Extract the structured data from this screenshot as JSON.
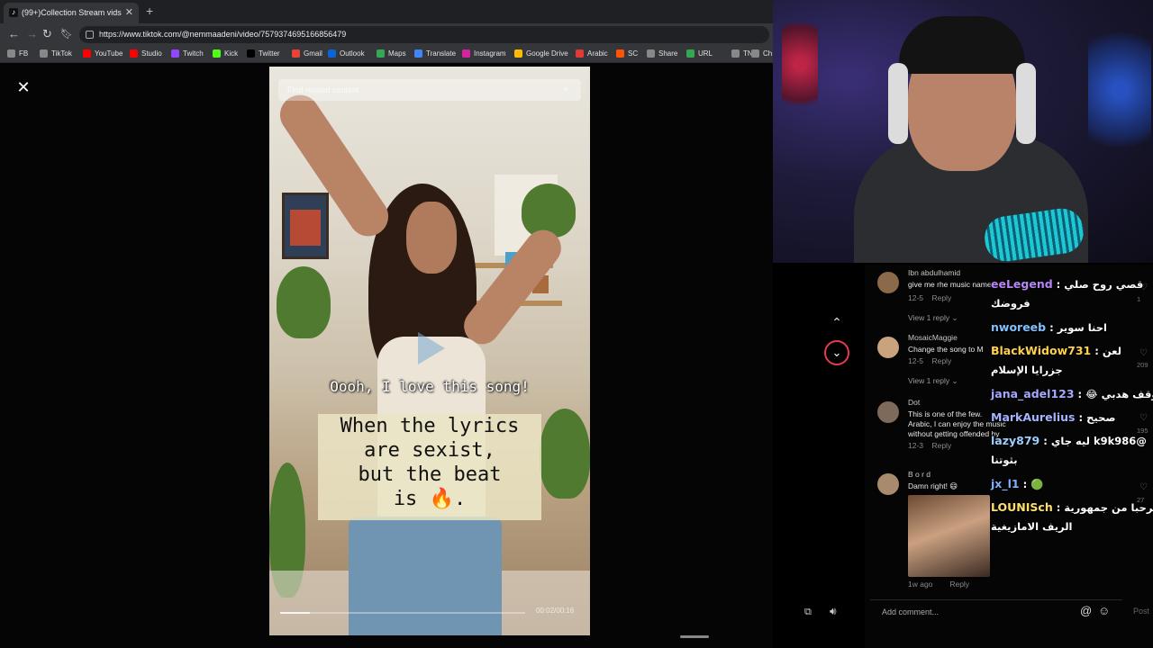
{
  "browser": {
    "tab_title": "(99+)Collection Stream vids",
    "url": "https://www.tiktok.com/@nemmaadeni/video/7579374695166856479",
    "bookmarks": [
      {
        "label": "FB",
        "color": "#888"
      },
      {
        "label": "TikTok",
        "color": "#888"
      },
      {
        "label": "YouTube",
        "color": "#ff0000"
      },
      {
        "label": "Studio",
        "color": "#ff0000"
      },
      {
        "label": "Twitch",
        "color": "#9146ff"
      },
      {
        "label": "Kick",
        "color": "#53fc18"
      },
      {
        "label": "Twitter",
        "color": "#000000"
      },
      {
        "label": "Gmail",
        "color": "#ea4335"
      },
      {
        "label": "Outlook",
        "color": "#0a64d8"
      },
      {
        "label": "Maps",
        "color": "#34a853"
      },
      {
        "label": "Translate",
        "color": "#4285f4"
      },
      {
        "label": "Instagram",
        "color": "#d6249f"
      },
      {
        "label": "Google Drive",
        "color": "#fbbc04"
      },
      {
        "label": "Arabic",
        "color": "#e53935"
      },
      {
        "label": "SC",
        "color": "#ff5500"
      },
      {
        "label": "Share",
        "color": "#888"
      },
      {
        "label": "URL",
        "color": "#34a853"
      },
      {
        "label": "TN",
        "color": "#888"
      },
      {
        "label": "Ch",
        "color": "#888"
      }
    ]
  },
  "video": {
    "search_placeholder": "Find related content",
    "lyric_small": "Oooh, I love this song!",
    "caption_lines": [
      "When the lyrics",
      "are sexist,",
      "but the beat",
      "is 🔥."
    ],
    "timestamp": "00:02/00:16",
    "progress_fraction": 0.12
  },
  "comments": [
    {
      "user": "Ibn abdulhamid",
      "text": "give me rhe music name",
      "date": "12-5",
      "reply": "Reply",
      "view_replies": "View 1 reply ⌄",
      "avatar_color": "#8a6a4a"
    },
    {
      "user": "MosaicMaggie",
      "text": "Change the song to M",
      "date": "12-5",
      "reply": "Reply",
      "view_replies": "View 1 reply ⌄",
      "avatar_color": "#c9a27e"
    },
    {
      "user": "Dot",
      "text": "This is one of the few. Arabic, I can enjoy the music without getting offended by the sometimes questionable",
      "date": "12-3",
      "reply": "Reply",
      "view_replies": "",
      "avatar_color": "#7d6a5a"
    },
    {
      "user": "B o r d",
      "text": "Damn right! 😄",
      "date": "1w ago",
      "reply": "Reply",
      "view_replies": "",
      "avatar_color": "#a88a6c"
    }
  ],
  "comment_bar": {
    "placeholder": "Add comment...",
    "post": "Post"
  },
  "like_counts": [
    "1",
    "209",
    "195",
    "27"
  ],
  "chat": [
    {
      "nick": "eeLegend",
      "color": "#b784f5",
      "msg": "قصي روح صلي"
    },
    {
      "nick": "",
      "color": "#ffffff",
      "msg": "فروضك"
    },
    {
      "nick": "nworeeb",
      "color": "#7fc0ff",
      "msg": "احنا سوير"
    },
    {
      "nick": "BlackWidow731",
      "color": "#ffd24a",
      "msg": "لعن"
    },
    {
      "nick": "",
      "color": "#ffffff",
      "msg": "جزرايا الإسلام"
    },
    {
      "nick": "jana_adel123",
      "color": "#a5a8ff",
      "msg": "اوقف هدبي 😂"
    },
    {
      "nick": "MarkAurelius",
      "color": "#a5b4ff",
      "msg": "صحيح"
    },
    {
      "nick": "lazy879",
      "color": "#9ad0ff",
      "msg": "@k9k986 ليه جاي"
    },
    {
      "nick": "",
      "color": "#ffffff",
      "msg": "بثوتنا"
    },
    {
      "nick": "jx_l1",
      "color": "#7fb0ff",
      "msg": "🟢"
    },
    {
      "nick": "LOUNISch",
      "color": "#ffe066",
      "msg": "مرحبا من جمهورية"
    },
    {
      "nick": "",
      "color": "#ffffff",
      "msg": "الريف الامازيغية"
    }
  ],
  "icons": {
    "close": "close-icon",
    "search": "search-icon",
    "arrow_up": "chevron-up-icon",
    "arrow_down": "chevron-down-icon",
    "at": "at-icon",
    "emoji": "emoji-icon",
    "volume": "volume-icon"
  }
}
